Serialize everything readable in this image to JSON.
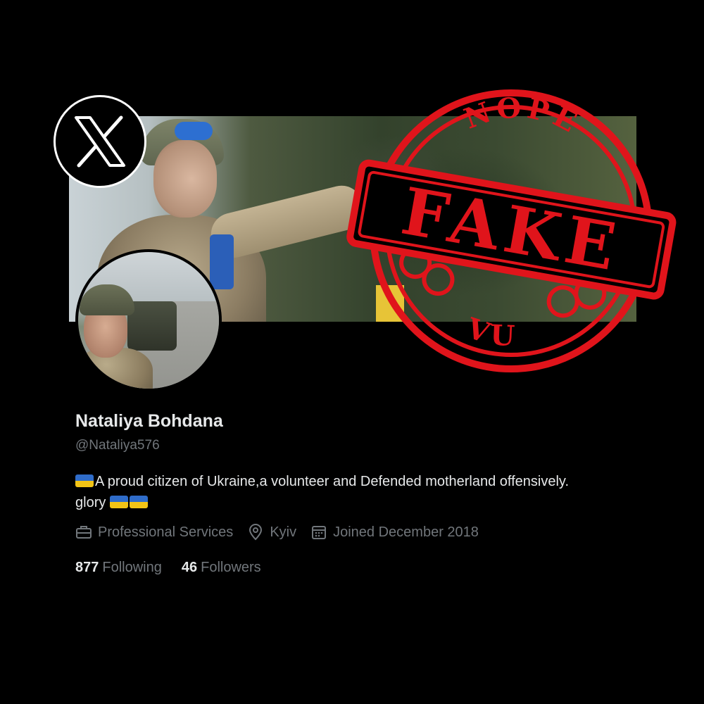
{
  "platform": {
    "logo_icon": "x-logo-icon"
  },
  "stamp": {
    "top_text": "NOPE",
    "main_text": "FAKE",
    "bottom_text": "VU",
    "color": "#e0141b"
  },
  "profile": {
    "name": "Nataliya Bohdana",
    "handle": "@Nataliya576",
    "bio_line1": "A proud citizen of Ukraine,a volunteer and Defended motherland offensively.",
    "bio_line2": "glory",
    "bio_emoji": "ukraine-flag-emoji",
    "category_icon": "briefcase-icon",
    "category": "Professional Services",
    "location_icon": "location-pin-icon",
    "location": "Kyiv",
    "joined_icon": "calendar-icon",
    "joined": "Joined December 2018",
    "following_count": "877",
    "following_label": "Following",
    "followers_count": "46",
    "followers_label": "Followers"
  },
  "colors": {
    "background": "#000000",
    "primary_text": "#e7e9ea",
    "secondary_text": "#71767b",
    "flag_blue": "#2f6cc9",
    "flag_yellow": "#f2c416"
  }
}
